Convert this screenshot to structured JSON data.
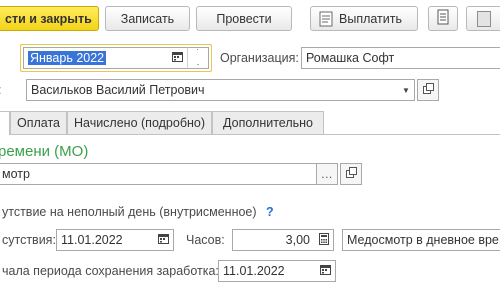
{
  "toolbar": {
    "post_close_label": "сти и закрыть",
    "save_label": "Записать",
    "post_label": "Провести",
    "pay_label": "Выплатить"
  },
  "header": {
    "month_value": "Январь 2022",
    "organization_label": "Организация:",
    "organization_value": "Ромашка Софт",
    "employee_label": ":",
    "employee_value": "Васильков Василий Петрович"
  },
  "tabs": [
    {
      "label": ""
    },
    {
      "label": "Оплата"
    },
    {
      "label": "Начислено (подробно)"
    },
    {
      "label": "Дополнительно"
    }
  ],
  "main": {
    "section_title": "ремени (МО)",
    "reason_value": "мотр",
    "partial_day_text": "утствие на неполный день (внутрисменное)",
    "help_mark": "?",
    "absence_date_label": "сутствия:",
    "absence_date_value": "11.01.2022",
    "hours_label": "Часов:",
    "hours_value": "3,00",
    "partial_type_value": "Медосмотр в дневное вре",
    "salary_period_label": "чала периода сохранения заработка:",
    "salary_period_value": "11.01.2022"
  },
  "colors": {
    "accent_yellow": "#f4d319",
    "section_green": "#3aa14a",
    "selection_blue": "#3875d7",
    "help_blue": "#2a6fd6"
  }
}
